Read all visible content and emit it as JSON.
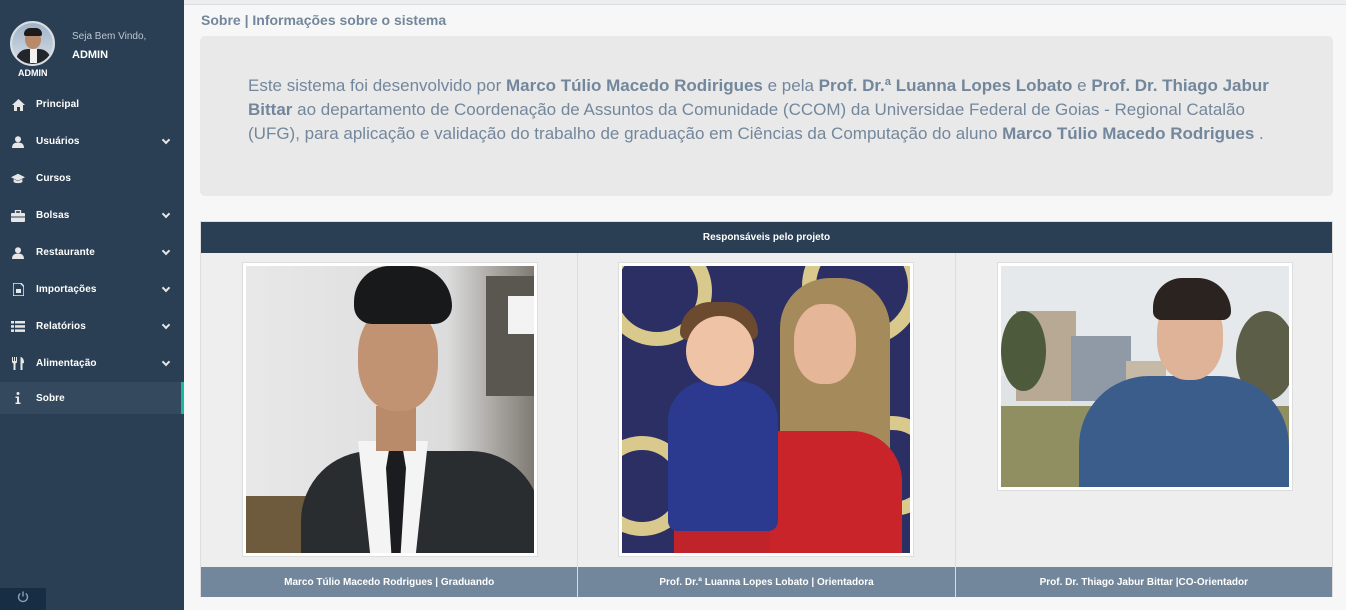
{
  "sidebar": {
    "welcome": "Seja Bem Vindo,",
    "user": "ADMIN",
    "avatar_label": "ADMIN",
    "items": [
      {
        "label": "Principal",
        "icon": "home-icon"
      },
      {
        "label": "Usuários",
        "icon": "user-icon"
      },
      {
        "label": "Cursos",
        "icon": "graduation-cap-icon"
      },
      {
        "label": "Bolsas",
        "icon": "briefcase-icon"
      },
      {
        "label": "Restaurante",
        "icon": "user-icon"
      },
      {
        "label": "Importações",
        "icon": "file-icon"
      },
      {
        "label": "Relatórios",
        "icon": "list-icon"
      },
      {
        "label": "Alimentação",
        "icon": "cutlery-icon"
      },
      {
        "label": "Sobre",
        "icon": "info-icon"
      }
    ]
  },
  "page": {
    "title": "Sobre | Informações sobre o sistema"
  },
  "about": {
    "t1": "Este sistema foi desenvolvido por ",
    "b1": "Marco Túlio Macedo Rodirigues",
    "t2": " e pela ",
    "b2": "Prof. Dr.ª Luanna Lopes Lobato",
    "t3": " e ",
    "b3": "Prof. Dr. Thiago Jabur Bittar",
    "t4": " ao departamento de Coordenação de Assuntos da Comunidade (CCOM) da Universidae Federal de Goias - Regional Catalão (UFG), para aplicação e validação do trabalho de graduação em Ciências da Computação do aluno ",
    "b4": "Marco Túlio Macedo Rodrigues",
    "t5": " ."
  },
  "responsaveis": {
    "header": "Responsáveis pelo projeto",
    "people": [
      {
        "caption": "Marco Túlio Macedo Rodrigues | Graduando"
      },
      {
        "caption": "Prof. Dr.ª Luanna Lopes Lobato | Orientadora"
      },
      {
        "caption": "Prof. Dr. Thiago Jabur Bittar |CO-Orientador"
      }
    ]
  },
  "colors": {
    "sidebar": "#2a3f54",
    "accent": "#1abb9c",
    "text": "#73879c"
  }
}
